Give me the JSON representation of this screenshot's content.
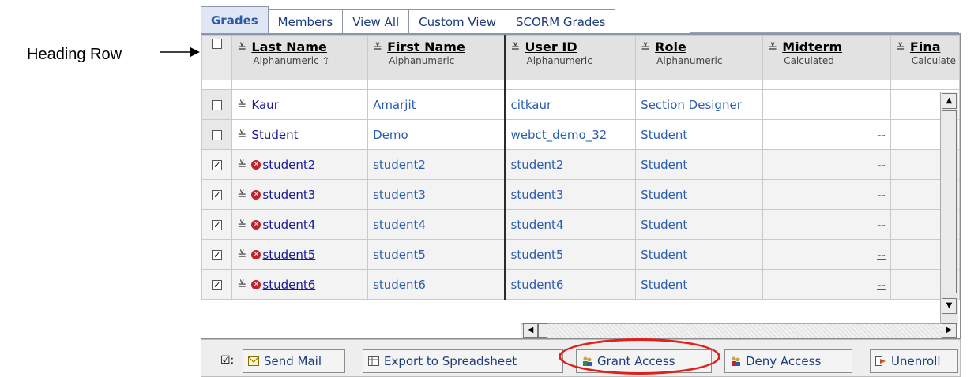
{
  "annotation": {
    "label": "Heading Row"
  },
  "tabs": [
    "Grades",
    "Members",
    "View All",
    "Custom View",
    "SCORM Grades"
  ],
  "columns": [
    {
      "title": "Last Name",
      "sub": "Alphanumeric ⇧"
    },
    {
      "title": "First Name",
      "sub": "Alphanumeric"
    },
    {
      "title": "User ID",
      "sub": "Alphanumeric"
    },
    {
      "title": "Role",
      "sub": "Alphanumeric"
    },
    {
      "title": "Midterm",
      "sub": "Calculated"
    },
    {
      "title": "Fina",
      "sub": "Calculate"
    }
  ],
  "rows": [
    {
      "checked": false,
      "flag": false,
      "last": "Kaur",
      "first": "Amarjit",
      "uid": "citkaur",
      "role": "Section Designer",
      "mid": ""
    },
    {
      "checked": false,
      "flag": false,
      "last": "Student",
      "first": "Demo",
      "uid": "webct_demo_32",
      "role": "Student",
      "mid": "--"
    },
    {
      "checked": true,
      "flag": true,
      "last": "student2",
      "first": "student2",
      "uid": "student2",
      "role": "Student",
      "mid": "--"
    },
    {
      "checked": true,
      "flag": true,
      "last": "student3",
      "first": "student3",
      "uid": "student3",
      "role": "Student",
      "mid": "--"
    },
    {
      "checked": true,
      "flag": true,
      "last": "student4",
      "first": "student4",
      "uid": "student4",
      "role": "Student",
      "mid": "--"
    },
    {
      "checked": true,
      "flag": true,
      "last": "student5",
      "first": "student5",
      "uid": "student5",
      "role": "Student",
      "mid": "--"
    },
    {
      "checked": true,
      "flag": true,
      "last": "student6",
      "first": "student6",
      "uid": "student6",
      "role": "Student",
      "mid": "--"
    }
  ],
  "actions": {
    "send_mail": "Send Mail",
    "export": "Export to Spreadsheet",
    "grant": "Grant Access",
    "deny": "Deny Access",
    "unenroll": "Unenroll"
  },
  "colors": {
    "highlight_ring": "#e0201a",
    "link": "#2a5db0",
    "tab_active": "#2f58a8"
  }
}
